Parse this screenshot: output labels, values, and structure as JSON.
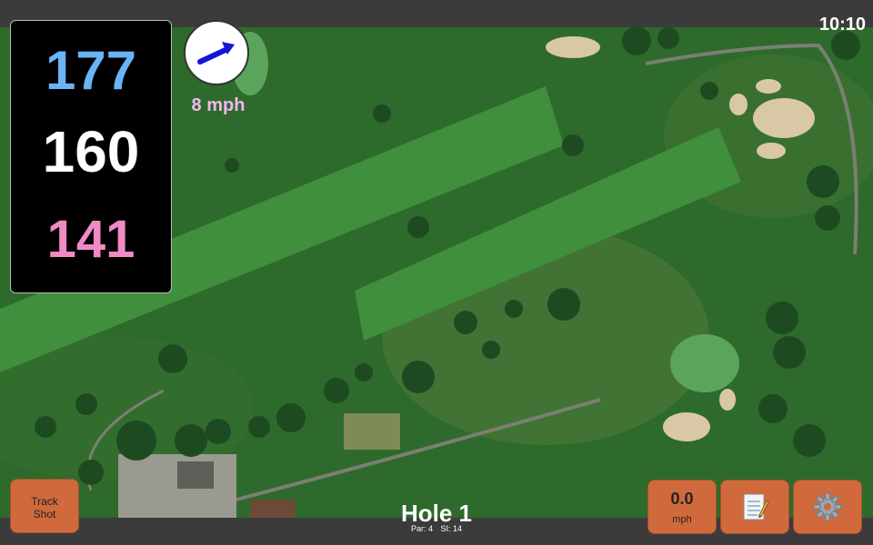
{
  "status": {
    "time": "10:10"
  },
  "distances": {
    "back": "177",
    "middle": "160",
    "front": "141",
    "colors": {
      "back": "#6ab4f5",
      "middle": "#ffffff",
      "front": "#f08ac4"
    }
  },
  "wind": {
    "speed": "8 mph",
    "icon": "wind-arrow-icon",
    "arrow_color": "#1414d8"
  },
  "buttons": {
    "track_shot_line1": "Track",
    "track_shot_line2": "Shot",
    "speed_value": "0.0",
    "speed_unit": "mph",
    "notes_icon": "notepad-icon",
    "settings_icon": "gear-icon",
    "button_color": "#d06a3c"
  },
  "hole": {
    "title": "Hole 1",
    "par": "Par: 4",
    "stroke_index": "SI: 14"
  }
}
